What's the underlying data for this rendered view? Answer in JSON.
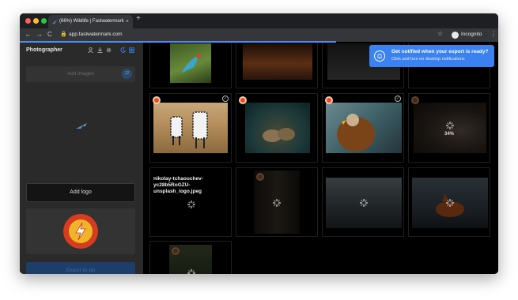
{
  "browser": {
    "tab_title": "(66%) Wildlife | Fastwatermark",
    "tab_close": "×",
    "new_tab": "+",
    "url": "app.fastwatermark.com",
    "profile": "Incognito",
    "nav_back": "←",
    "nav_forward": "→",
    "nav_reload": "C",
    "star": "☆",
    "menu": "⋮"
  },
  "sidebar": {
    "title": "Photographer",
    "add_images_label": "Add images",
    "image_count": "12",
    "add_logo_label": "Add logo",
    "export_label": "Export to zip"
  },
  "notification": {
    "title": "Get notified when your export is ready?",
    "subtitle": "Click and turn on desktop notifications"
  },
  "grid": {
    "row2_progress": "34%",
    "filename": "nikolay-tchaouchev-yc28b5RoGZU-unsplash_logo.jpeg",
    "check_mark": "✓"
  },
  "colors": {
    "accent": "#3b82f0",
    "logo_red": "#d63c20",
    "logo_yellow": "#f0b429"
  }
}
